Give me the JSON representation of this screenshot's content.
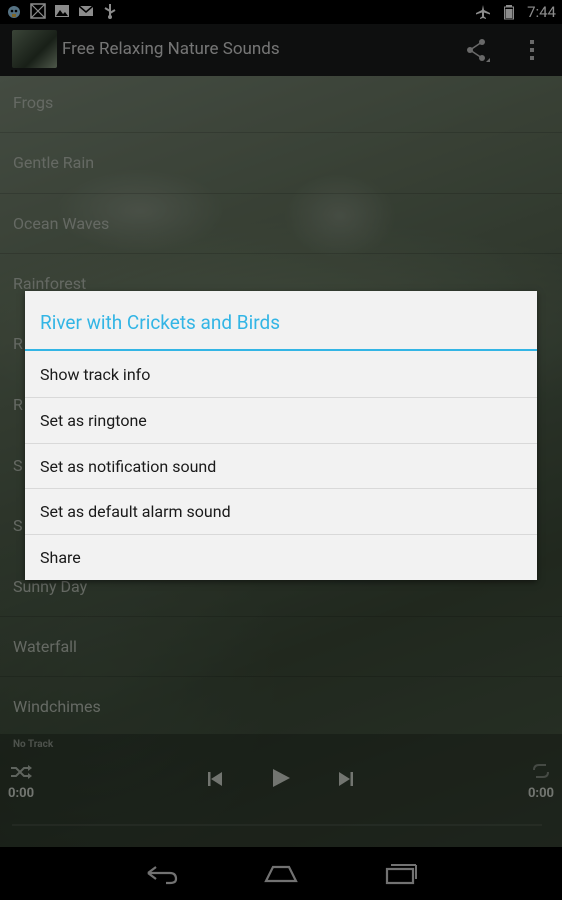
{
  "status_bar": {
    "time": "7:44",
    "icons_left": [
      "android-debug-icon",
      "photo-icon",
      "gallery-icon",
      "gmail-icon",
      "usb-icon"
    ],
    "icons_right": [
      "airplane-mode-icon",
      "battery-icon"
    ]
  },
  "action_bar": {
    "title": "Free Relaxing Nature Sounds",
    "share_icon": "share-icon",
    "overflow_icon": "overflow-menu-icon"
  },
  "tracks": [
    "Frogs",
    "Gentle Rain",
    "Ocean Waves",
    "Rainforest",
    "R",
    "R",
    "S",
    "S",
    "Sunny Day",
    "Waterfall",
    "Windchimes"
  ],
  "player": {
    "track_label": "No Track",
    "elapsed": "0:00",
    "duration": "0:00",
    "icons": [
      "shuffle-icon",
      "previous-icon",
      "play-icon",
      "next-icon",
      "repeat-icon"
    ]
  },
  "dialog": {
    "title": "River with Crickets and Birds",
    "accent_color": "#33b5e5",
    "items": [
      {
        "label": "Show track info"
      },
      {
        "label": "Set as ringtone"
      },
      {
        "label": "Set as notification sound"
      },
      {
        "label": "Set as default alarm sound"
      },
      {
        "label": "Share"
      }
    ]
  },
  "nav_bar": {
    "icons": [
      "back-icon",
      "home-icon",
      "recent-apps-icon"
    ]
  }
}
